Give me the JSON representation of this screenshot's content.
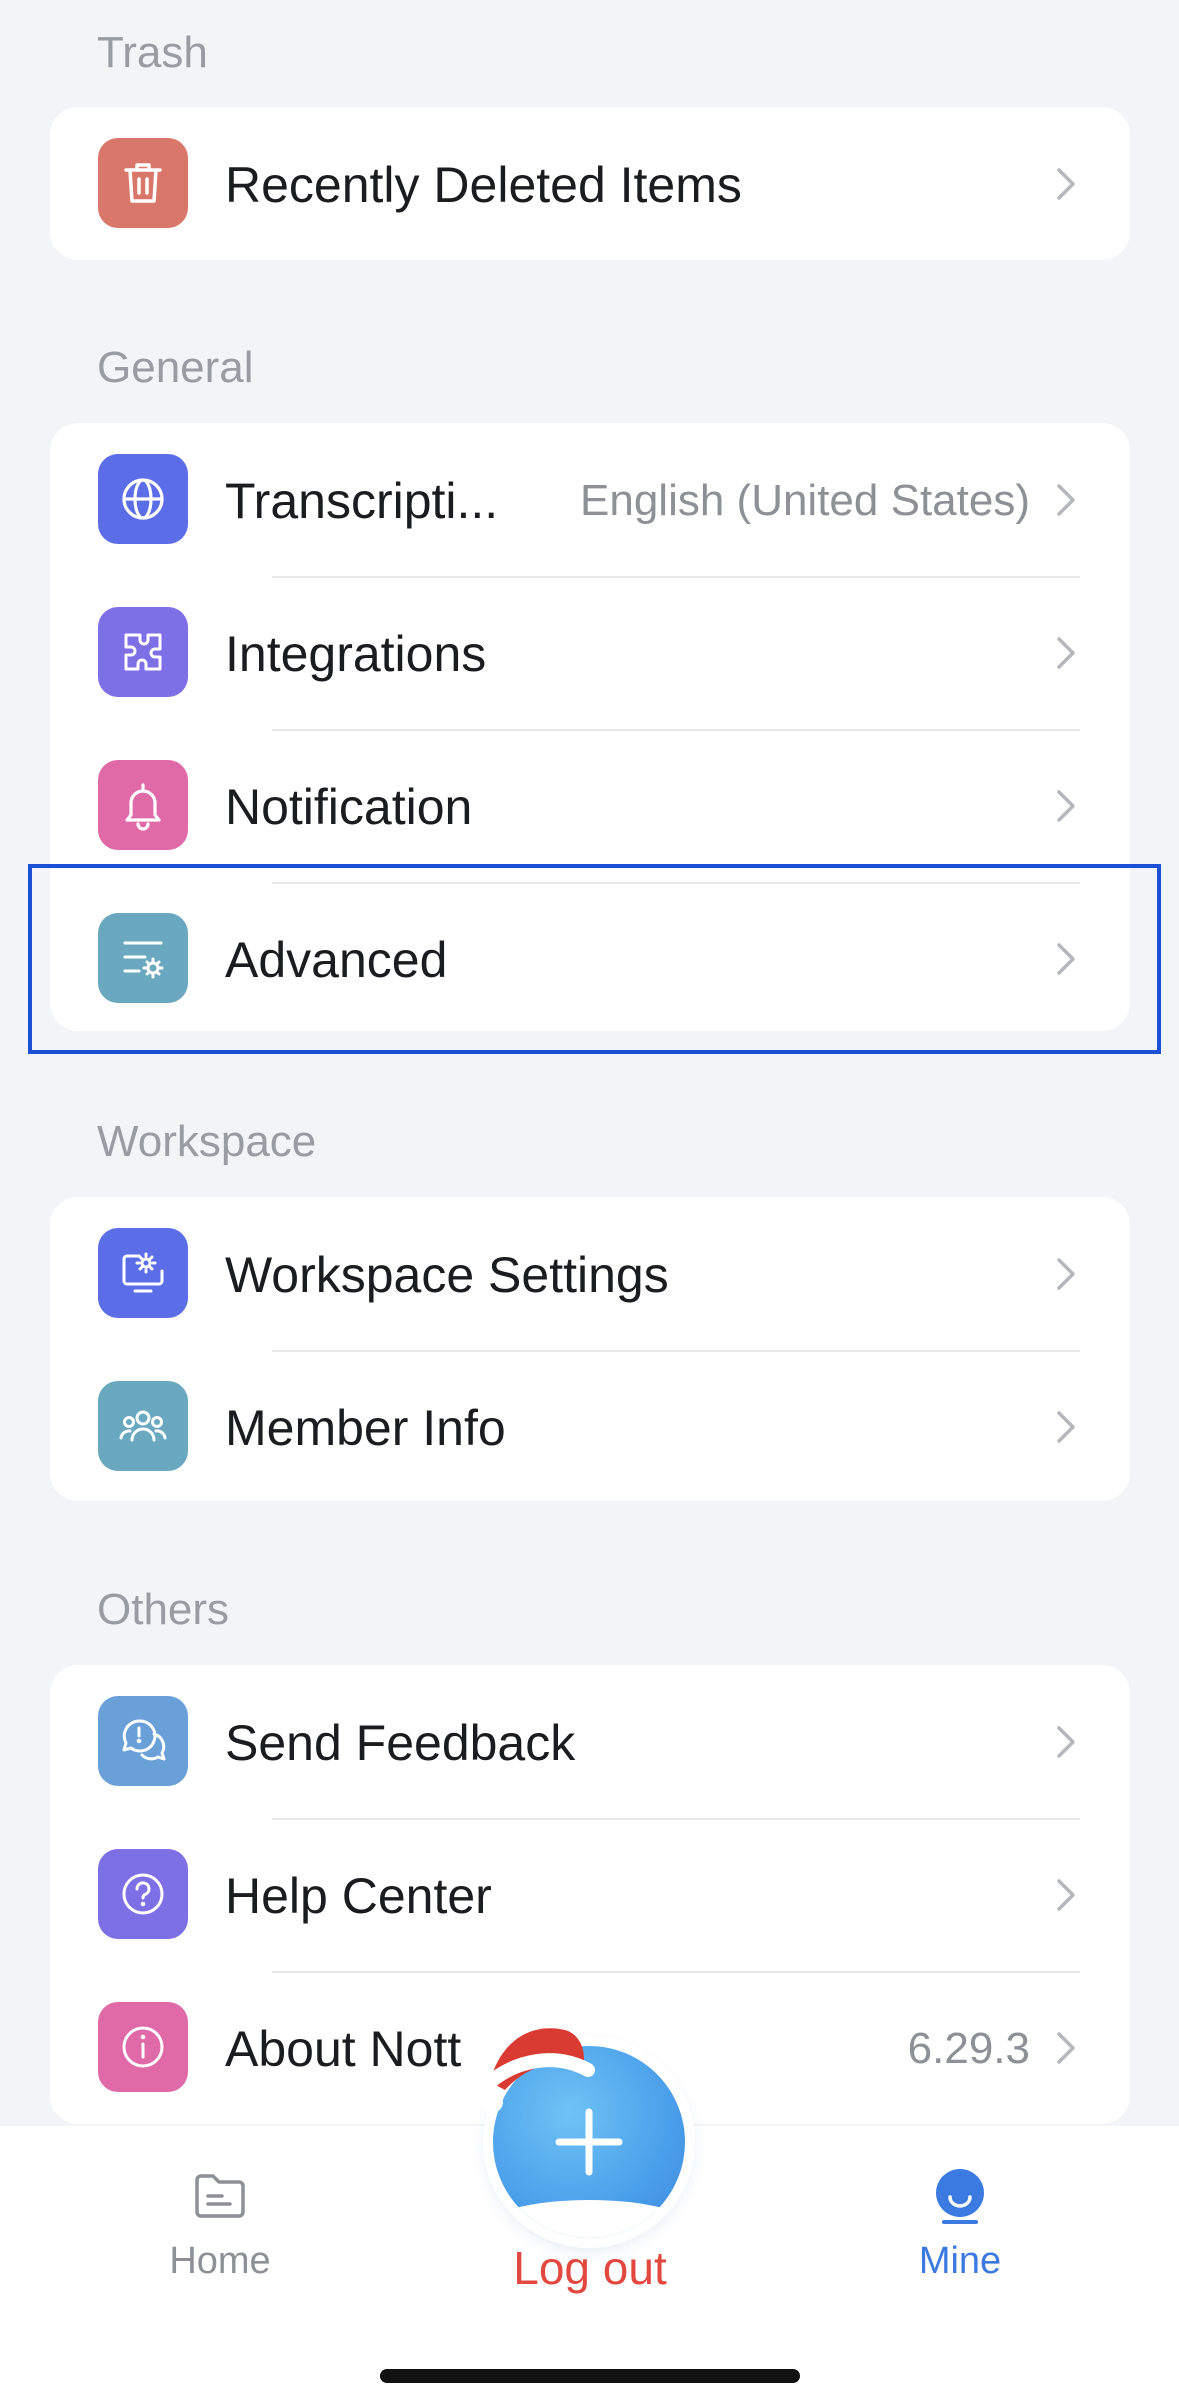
{
  "sections": {
    "trash": {
      "title": "Trash",
      "items": [
        {
          "label": "Recently Deleted Items",
          "icon": "trash-icon",
          "color": "#d9776a"
        }
      ]
    },
    "general": {
      "title": "General",
      "items": [
        {
          "label": "Transcripti...",
          "value": "English (United States)",
          "icon": "globe-icon",
          "color": "#5b6ee8"
        },
        {
          "label": "Integrations",
          "icon": "puzzle-icon",
          "color": "#7d6fe6"
        },
        {
          "label": "Notification",
          "icon": "bell-icon",
          "color": "#e06aa8"
        },
        {
          "label": "Advanced",
          "icon": "settings-list-icon",
          "color": "#6aa8c0"
        }
      ]
    },
    "workspace": {
      "title": "Workspace",
      "items": [
        {
          "label": "Workspace Settings",
          "icon": "workspace-settings-icon",
          "color": "#5b6ee8"
        },
        {
          "label": "Member Info",
          "icon": "members-icon",
          "color": "#6aa8c0"
        }
      ]
    },
    "others": {
      "title": "Others",
      "items": [
        {
          "label": "Send Feedback",
          "icon": "feedback-icon",
          "color": "#6aa0d8"
        },
        {
          "label": "Help Center",
          "icon": "help-icon",
          "color": "#7d6fe6"
        },
        {
          "label": "About Nott",
          "value": "6.29.3",
          "icon": "info-icon",
          "color": "#e06aa8"
        }
      ]
    }
  },
  "logout_label": "Log out",
  "tabbar": {
    "home_label": "Home",
    "mine_label": "Mine",
    "active_color": "#3b7ae0",
    "inactive_color": "#8e9097"
  }
}
